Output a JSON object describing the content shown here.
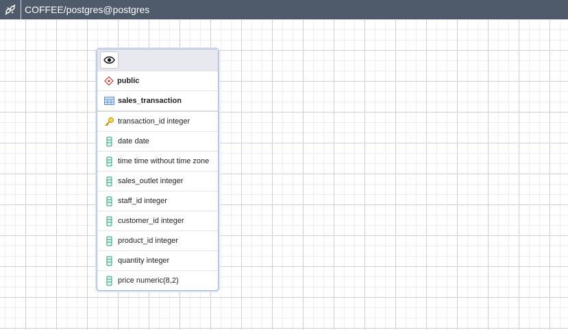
{
  "header": {
    "title": "COFFEE/postgres@postgres"
  },
  "table": {
    "schema": "public",
    "name": "sales_transaction",
    "columns": [
      {
        "label": "transaction_id integer",
        "icon": "key-icon"
      },
      {
        "label": "date date",
        "icon": "column-icon"
      },
      {
        "label": "time time without time zone",
        "icon": "column-icon"
      },
      {
        "label": "sales_outlet integer",
        "icon": "column-icon"
      },
      {
        "label": "staff_id integer",
        "icon": "column-icon"
      },
      {
        "label": "customer_id integer",
        "icon": "column-icon"
      },
      {
        "label": "product_id integer",
        "icon": "column-icon"
      },
      {
        "label": "quantity integer",
        "icon": "column-icon"
      },
      {
        "label": "price numeric(8,2)",
        "icon": "column-icon"
      }
    ]
  }
}
